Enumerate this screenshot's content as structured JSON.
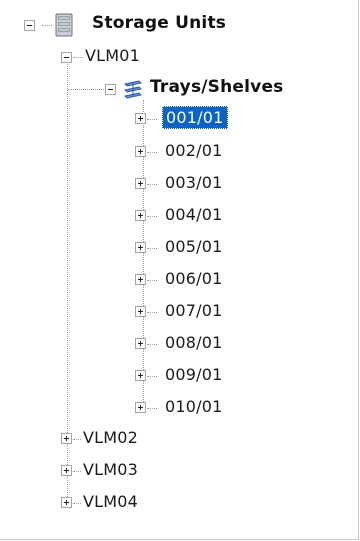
{
  "tree": {
    "root": {
      "label": "Storage Units",
      "icon": "server-cabinet-icon",
      "expanded": true
    },
    "units": [
      {
        "label": "VLM01",
        "expanded": true,
        "group": {
          "label": "Trays/Shelves",
          "icon": "tray-stack-icon",
          "expanded": true,
          "items": [
            "001/01",
            "002/01",
            "003/01",
            "004/01",
            "005/01",
            "006/01",
            "007/01",
            "008/01",
            "009/01",
            "010/01"
          ],
          "selected_index": 0
        }
      },
      {
        "label": "VLM02",
        "expanded": false
      },
      {
        "label": "VLM03",
        "expanded": false
      },
      {
        "label": "VLM04",
        "expanded": false
      }
    ]
  }
}
